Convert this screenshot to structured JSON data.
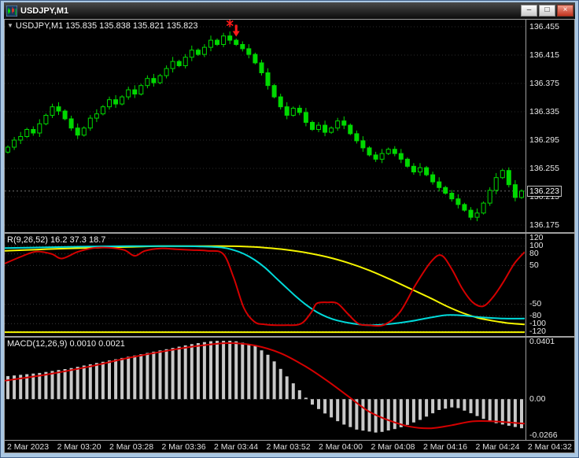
{
  "window": {
    "title": "USDJPY,M1",
    "controls": {
      "minimize": "–",
      "maximize": "□",
      "close": "×"
    }
  },
  "main_chart": {
    "shift_marker": "▼",
    "label": "USDJPY,M1 135.835 135.838 135.821 135.823",
    "bid_tag": "136.223"
  },
  "oscillator": {
    "label": "R(9,26,52) 16.2 37.3 18.7"
  },
  "macd": {
    "label": "MACD(12,26,9) 0.0010 0.0021"
  },
  "time_axis": [
    "2 Mar 2023",
    "2 Mar 03:20",
    "2 Mar 03:28",
    "2 Mar 03:36",
    "2 Mar 03:44",
    "2 Mar 03:52",
    "2 Mar 04:00",
    "2 Mar 04:08",
    "2 Mar 04:16",
    "2 Mar 04:24",
    "2 Mar 04:32"
  ],
  "colors": {
    "background": "#000000",
    "candle": "#00d800",
    "grid": "#2d2d2d",
    "scale_text": "#e8e8e8",
    "red_line": "#d40000",
    "cyan_line": "#00dada",
    "yellow_line": "#f5f500",
    "histogram": "#c8c8c8",
    "signal": "#ff1a1a",
    "frame": "#a9c7e3"
  },
  "chart_data": {
    "price": {
      "type": "candlestick",
      "symbol": "USDJPY",
      "timeframe": "M1",
      "ylim": [
        136.165,
        136.465
      ],
      "open_first": 136.278,
      "closes": [
        136.285,
        136.295,
        136.3,
        136.31,
        136.305,
        136.318,
        136.33,
        136.342,
        136.336,
        136.325,
        136.312,
        136.302,
        136.312,
        136.326,
        136.332,
        136.342,
        136.352,
        136.346,
        136.356,
        136.366,
        136.36,
        136.372,
        136.382,
        136.376,
        136.386,
        136.396,
        136.406,
        136.4,
        136.412,
        136.422,
        136.416,
        136.426,
        136.436,
        136.43,
        136.442,
        136.436,
        136.43,
        136.424,
        136.416,
        136.404,
        136.39,
        136.372,
        136.356,
        136.342,
        136.33,
        136.34,
        136.334,
        136.32,
        136.31,
        136.316,
        136.306,
        136.312,
        136.322,
        136.316,
        136.304,
        136.294,
        136.284,
        136.274,
        136.268,
        136.276,
        136.282,
        136.276,
        136.268,
        136.258,
        136.25,
        136.256,
        136.246,
        136.236,
        136.228,
        136.22,
        136.212,
        136.204,
        136.196,
        136.186,
        136.192,
        136.206,
        136.224,
        136.242,
        136.252,
        136.232,
        136.214,
        136.223
      ],
      "grid_prices": [
        136.455,
        136.415,
        136.375,
        136.335,
        136.295,
        136.255,
        136.215,
        136.175
      ],
      "bid": 136.223,
      "sell_signal": {
        "index": 36,
        "price": 136.44
      }
    },
    "oscillator": {
      "type": "line",
      "name": "R(9,26,52)",
      "values": [
        16.2,
        37.3,
        18.7
      ],
      "ylim": [
        -132,
        132
      ],
      "levels": [
        120,
        100,
        80,
        50,
        -50,
        -80,
        -100,
        -120
      ],
      "series": [
        {
          "name": "baseline",
          "color": "#f5f500",
          "points": [
            [
              0,
              -122
            ],
            [
              100,
              -122
            ]
          ]
        },
        {
          "name": "slow-yellow",
          "color": "#f5f500",
          "points": [
            [
              0,
              88
            ],
            [
              6,
              91
            ],
            [
              12,
              94
            ],
            [
              18,
              96
            ],
            [
              24,
              98
            ],
            [
              30,
              100
            ],
            [
              36,
              100
            ],
            [
              42,
              100
            ],
            [
              46,
              99
            ],
            [
              50,
              96
            ],
            [
              54,
              91
            ],
            [
              58,
              83
            ],
            [
              62,
              72
            ],
            [
              66,
              57
            ],
            [
              70,
              38
            ],
            [
              74,
              15
            ],
            [
              78,
              -10
            ],
            [
              82,
              -35
            ],
            [
              85,
              -55
            ],
            [
              88,
              -72
            ],
            [
              91,
              -85
            ],
            [
              94,
              -93
            ],
            [
              97,
              -99
            ],
            [
              100,
              -102
            ]
          ]
        },
        {
          "name": "mid-cyan",
          "color": "#00dada",
          "points": [
            [
              0,
              95
            ],
            [
              8,
              97
            ],
            [
              16,
              99
            ],
            [
              24,
              100
            ],
            [
              32,
              100
            ],
            [
              38,
              99
            ],
            [
              42,
              96
            ],
            [
              44,
              90
            ],
            [
              46,
              80
            ],
            [
              48,
              65
            ],
            [
              50,
              45
            ],
            [
              52,
              20
            ],
            [
              54,
              -5
            ],
            [
              56,
              -30
            ],
            [
              58,
              -52
            ],
            [
              60,
              -70
            ],
            [
              62,
              -83
            ],
            [
              64,
              -92
            ],
            [
              67,
              -100
            ],
            [
              70,
              -104
            ],
            [
              74,
              -101
            ],
            [
              78,
              -94
            ],
            [
              82,
              -84
            ],
            [
              85,
              -78
            ],
            [
              88,
              -79
            ],
            [
              92,
              -84
            ],
            [
              96,
              -87
            ],
            [
              100,
              -87
            ]
          ]
        },
        {
          "name": "fast-red",
          "color": "#d40000",
          "points": [
            [
              0,
              55
            ],
            [
              3,
              72
            ],
            [
              6,
              86
            ],
            [
              9,
              80
            ],
            [
              11,
              68
            ],
            [
              14,
              85
            ],
            [
              17,
              95
            ],
            [
              20,
              96
            ],
            [
              23,
              90
            ],
            [
              25,
              75
            ],
            [
              27,
              88
            ],
            [
              30,
              94
            ],
            [
              33,
              92
            ],
            [
              36,
              90
            ],
            [
              39,
              88
            ],
            [
              42,
              80
            ],
            [
              44,
              20
            ],
            [
              46,
              -60
            ],
            [
              48,
              -95
            ],
            [
              50,
              -102
            ],
            [
              54,
              -104
            ],
            [
              57,
              -100
            ],
            [
              59,
              -70
            ],
            [
              60,
              -48
            ],
            [
              62,
              -45
            ],
            [
              64,
              -48
            ],
            [
              66,
              -75
            ],
            [
              68,
              -100
            ],
            [
              70,
              -104
            ],
            [
              73,
              -103
            ],
            [
              76,
              -70
            ],
            [
              79,
              0
            ],
            [
              82,
              60
            ],
            [
              84,
              76
            ],
            [
              86,
              40
            ],
            [
              88,
              -10
            ],
            [
              90,
              -45
            ],
            [
              92,
              -55
            ],
            [
              94,
              -30
            ],
            [
              96,
              10
            ],
            [
              98,
              55
            ],
            [
              100,
              85
            ]
          ]
        }
      ]
    },
    "macd": {
      "type": "macd",
      "name": "MACD(12,26,9)",
      "values": [
        0.001,
        0.0021
      ],
      "ylim": [
        -0.0266,
        0.0401
      ],
      "scale": [
        [
          "0.0401",
          0.0401
        ],
        [
          "0.00",
          0
        ],
        [
          "-0.0266",
          -0.0266
        ]
      ],
      "histogram_keypoints": [
        [
          0,
          0.015
        ],
        [
          6,
          0.017
        ],
        [
          12,
          0.02
        ],
        [
          18,
          0.024
        ],
        [
          24,
          0.028
        ],
        [
          30,
          0.032
        ],
        [
          36,
          0.036
        ],
        [
          40,
          0.038
        ],
        [
          44,
          0.038
        ],
        [
          48,
          0.035
        ],
        [
          51,
          0.028
        ],
        [
          54,
          0.016
        ],
        [
          57,
          0.005
        ],
        [
          59,
          -0.003
        ],
        [
          62,
          -0.01
        ],
        [
          65,
          -0.016
        ],
        [
          68,
          -0.02
        ],
        [
          72,
          -0.022
        ],
        [
          76,
          -0.019
        ],
        [
          80,
          -0.014
        ],
        [
          84,
          -0.007
        ],
        [
          87,
          -0.005
        ],
        [
          90,
          -0.009
        ],
        [
          94,
          -0.015
        ],
        [
          100,
          -0.019
        ]
      ],
      "signal_keypoints": [
        [
          0,
          0.012
        ],
        [
          8,
          0.016
        ],
        [
          16,
          0.021
        ],
        [
          24,
          0.027
        ],
        [
          32,
          0.032
        ],
        [
          38,
          0.035
        ],
        [
          43,
          0.0365
        ],
        [
          48,
          0.035
        ],
        [
          53,
          0.03
        ],
        [
          58,
          0.021
        ],
        [
          62,
          0.012
        ],
        [
          66,
          0.002
        ],
        [
          70,
          -0.008
        ],
        [
          74,
          -0.014
        ],
        [
          78,
          -0.018
        ],
        [
          82,
          -0.019
        ],
        [
          86,
          -0.017
        ],
        [
          90,
          -0.0145
        ],
        [
          94,
          -0.0145
        ],
        [
          100,
          -0.016
        ]
      ]
    }
  }
}
